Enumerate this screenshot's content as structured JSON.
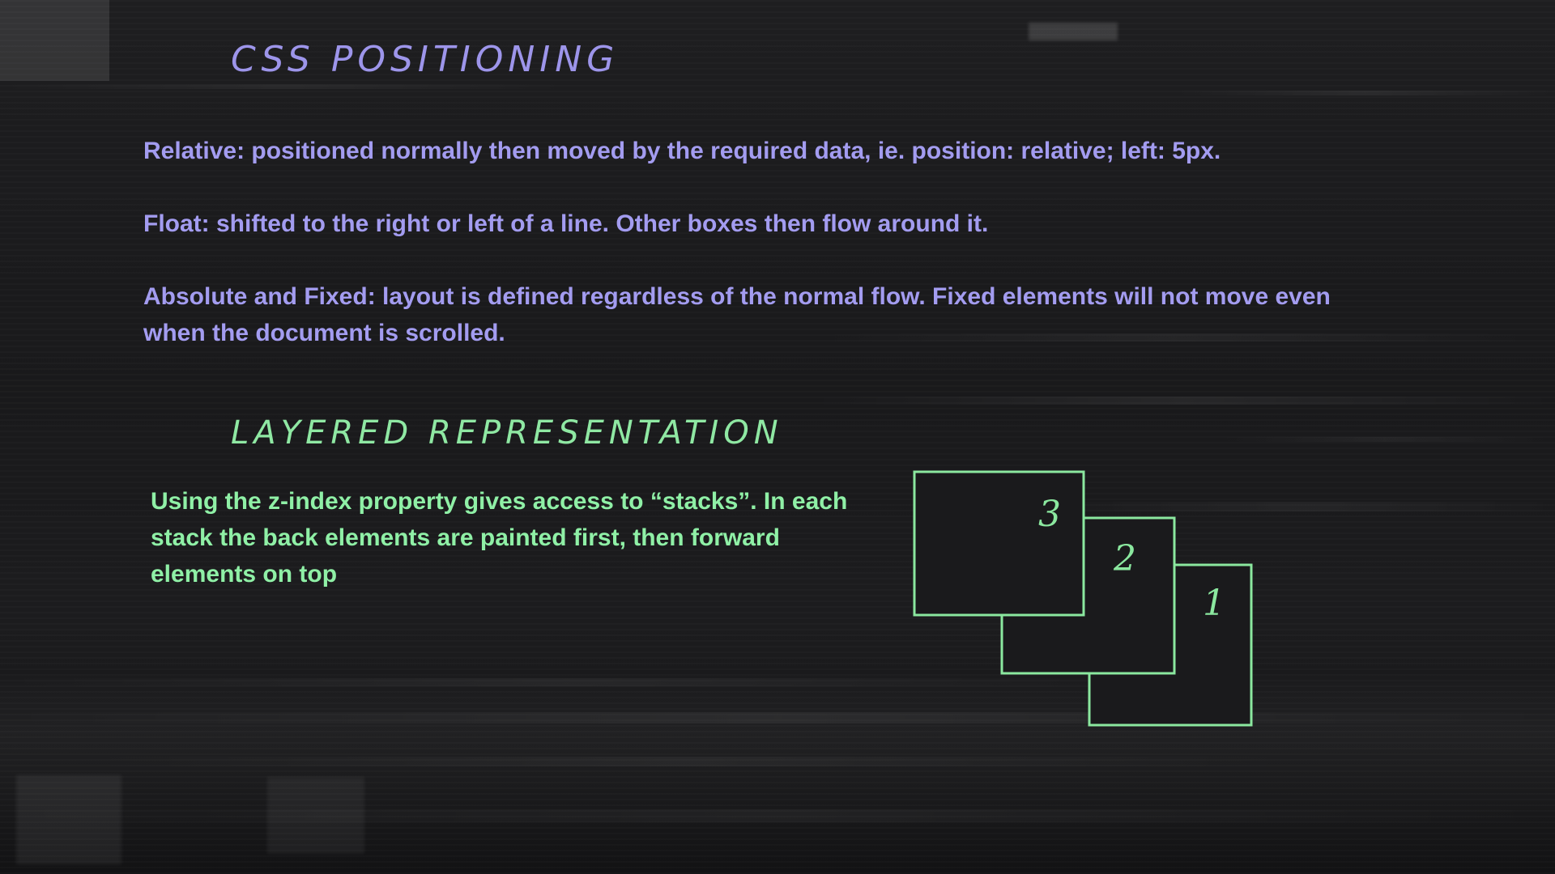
{
  "slide": {
    "title": "CSS POSITIONING",
    "paragraphs": {
      "relative": "Relative: positioned normally then moved by the required data, ie. position: relative; left: 5px.",
      "float": "Float: shifted to the right or left of a line. Other boxes then flow around it.",
      "absolute": "Absolute and Fixed: layout is defined regardless of the normal flow. Fixed elements will not move even when the document is scrolled."
    },
    "subtitle": "LAYERED REPRESENTATION",
    "zindex_text": "Using the z-index property gives access to “stacks”. In each stack the back elements are painted first, then forward elements on top",
    "diagram": {
      "boxes": [
        {
          "label": "3"
        },
        {
          "label": "2"
        },
        {
          "label": "1"
        }
      ]
    },
    "colors": {
      "purple_text": "#a39cf0",
      "green_text": "#8ff0a6",
      "background": "#1b1b1d"
    }
  }
}
